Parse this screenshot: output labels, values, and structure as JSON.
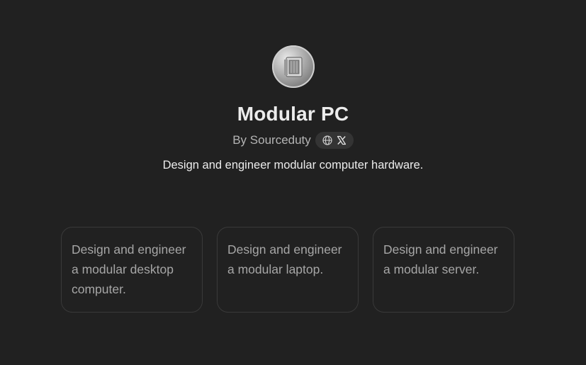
{
  "gpt": {
    "title": "Modular PC",
    "byline": "By Sourceduty",
    "description": "Design and engineer modular computer hardware."
  },
  "icons": {
    "avatar": "modular-pc-case-image",
    "website": "globe-icon",
    "social": "x-logo-icon"
  },
  "conversation_starters": [
    {
      "text": "Design and engineer a modular desktop computer."
    },
    {
      "text": "Design and engineer a modular laptop."
    },
    {
      "text": "Design and engineer a modular server."
    }
  ],
  "colors": {
    "background": "#212121",
    "pill_background": "#343434",
    "card_border": "#3a3a3a",
    "title_text": "#ececec",
    "muted_text": "#b4b4b4"
  }
}
